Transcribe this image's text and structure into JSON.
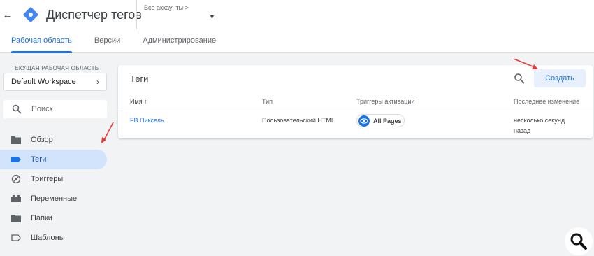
{
  "header": {
    "app_title": "Диспетчер тегов",
    "account_label": "Все аккаунты >",
    "back_icon": "arrow-back-icon",
    "logo_icon": "gtm-logo",
    "brand_color": "#4285f4"
  },
  "tabs": [
    {
      "label": "Рабочая область",
      "active": true
    },
    {
      "label": "Версии",
      "active": false
    },
    {
      "label": "Администрирование",
      "active": false
    }
  ],
  "sidebar": {
    "workspace_label": "ТЕКУЩАЯ РАБОЧАЯ ОБЛАСТЬ",
    "workspace_name": "Default Workspace",
    "search_placeholder": "Поиск",
    "items": [
      {
        "label": "Обзор",
        "icon": "folder-icon",
        "active": false
      },
      {
        "label": "Теги",
        "icon": "tag-icon",
        "active": true
      },
      {
        "label": "Триггеры",
        "icon": "trigger-icon",
        "active": false
      },
      {
        "label": "Переменные",
        "icon": "variables-icon",
        "active": false
      },
      {
        "label": "Папки",
        "icon": "folder-icon",
        "active": false
      },
      {
        "label": "Шаблоны",
        "icon": "template-icon",
        "active": false
      }
    ]
  },
  "main": {
    "title": "Теги",
    "create_label": "Создать",
    "columns": [
      "Имя ↑",
      "Тип",
      "Триггеры активации",
      "Последнее изменение"
    ],
    "rows": [
      {
        "name": "FB Пиксель",
        "type": "Пользовательский HTML",
        "trigger": "All Pages",
        "modified_line1": "несколько секунд",
        "modified_line2": "назад"
      }
    ]
  },
  "colors": {
    "accent": "#1a73e8",
    "annotation_arrow": "#e53935",
    "active_nav_bg": "#d2e3fc"
  }
}
